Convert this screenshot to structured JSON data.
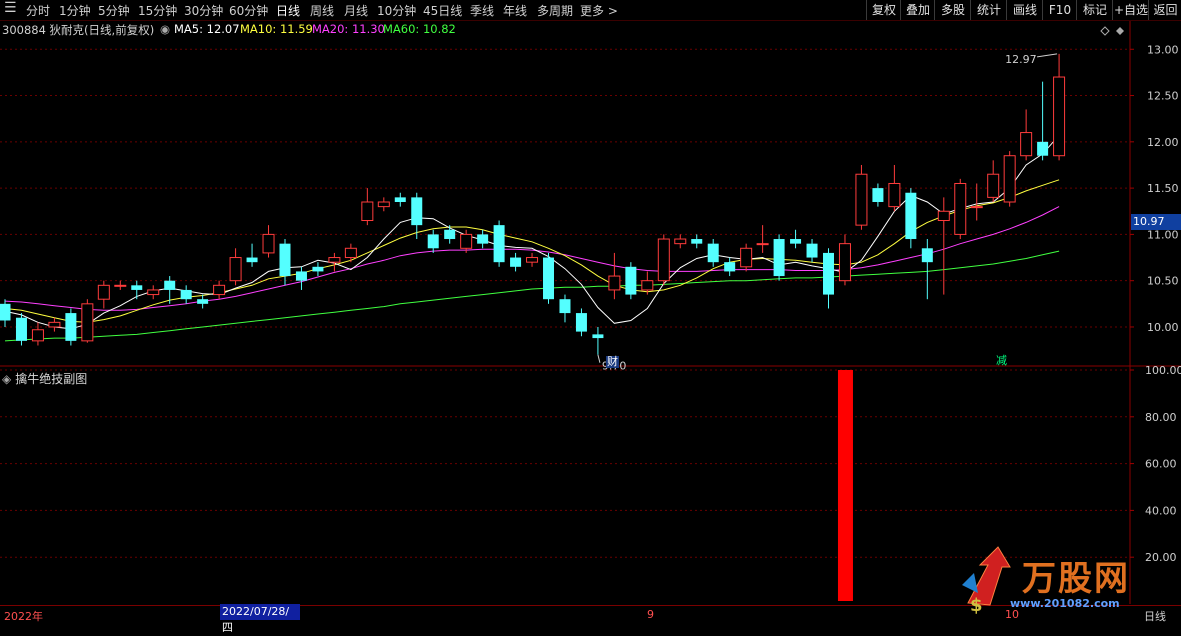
{
  "toolbar": {
    "periods": [
      "分时",
      "1分钟",
      "5分钟",
      "15分钟",
      "30分钟",
      "60分钟",
      "日线",
      "周线",
      "月线",
      "10分钟",
      "45日线",
      "季线",
      "年线",
      "多周期",
      "更多 >"
    ],
    "active": "日线",
    "right_buttons": [
      "复权",
      "叠加",
      "多股",
      "统计",
      "画线",
      "F10",
      "标记",
      "+自选",
      "返回"
    ]
  },
  "info": {
    "stock": "300884 狄耐克(日线,前复权)",
    "ma5": "MA5: 12.07",
    "ma10": "MA10: 11.59",
    "ma20": "MA20: 11.30",
    "ma60": "MA60: 10.82"
  },
  "colors": {
    "up": "#ff3c3c",
    "down": "#54ffff",
    "ma5": "#ffffff",
    "ma10": "#ffff40",
    "ma20": "#ff40ff",
    "ma60": "#40ff40",
    "indicator_bar": "#ff0000"
  },
  "annotations": {
    "high": "12.97",
    "low": "9.70",
    "cai": "财",
    "jian": "减"
  },
  "price_badge": "10.97",
  "sub_title": "擒牛绝技副图",
  "bottom": {
    "year": "2022年",
    "cursor_date": "2022/07/28/四",
    "m9": "9",
    "m10": "10",
    "period": "日线"
  },
  "watermark": {
    "text": "万股网",
    "url": "www.201082.com"
  },
  "chart_data": [
    {
      "type": "candlestick",
      "y_ticks": [
        10.0,
        10.5,
        11.0,
        11.5,
        12.0,
        12.5,
        13.0
      ],
      "ylim": [
        9.6,
        13.1
      ],
      "candles": [
        [
          10.25,
          10.07,
          10.3,
          10.0
        ],
        [
          10.1,
          9.85,
          10.15,
          9.8
        ],
        [
          9.85,
          9.97,
          10.05,
          9.8
        ],
        [
          10.0,
          10.05,
          10.1,
          9.95
        ],
        [
          10.15,
          9.85,
          10.2,
          9.8
        ],
        [
          9.85,
          10.25,
          10.3,
          9.83
        ],
        [
          10.3,
          10.45,
          10.5,
          10.2
        ],
        [
          10.45,
          10.45,
          10.5,
          10.4
        ],
        [
          10.45,
          10.4,
          10.5,
          10.3
        ],
        [
          10.35,
          10.4,
          10.45,
          10.3
        ],
        [
          10.5,
          10.4,
          10.55,
          10.25
        ],
        [
          10.4,
          10.3,
          10.45,
          10.25
        ],
        [
          10.3,
          10.25,
          10.35,
          10.2
        ],
        [
          10.35,
          10.45,
          10.5,
          10.3
        ],
        [
          10.5,
          10.75,
          10.85,
          10.45
        ],
        [
          10.75,
          10.7,
          10.9,
          10.65
        ],
        [
          10.8,
          11.0,
          11.1,
          10.75
        ],
        [
          10.9,
          10.55,
          10.95,
          10.45
        ],
        [
          10.6,
          10.5,
          10.65,
          10.4
        ],
        [
          10.65,
          10.6,
          10.7,
          10.55
        ],
        [
          10.7,
          10.75,
          10.8,
          10.6
        ],
        [
          10.75,
          10.85,
          10.9,
          10.7
        ],
        [
          11.15,
          11.35,
          11.5,
          11.1
        ],
        [
          11.3,
          11.35,
          11.4,
          11.25
        ],
        [
          11.4,
          11.35,
          11.45,
          11.3
        ],
        [
          11.4,
          11.1,
          11.45,
          10.95
        ],
        [
          11.0,
          10.85,
          11.05,
          10.8
        ],
        [
          11.05,
          10.95,
          11.1,
          10.9
        ],
        [
          10.85,
          11.0,
          11.05,
          10.8
        ],
        [
          11.0,
          10.9,
          11.05,
          10.85
        ],
        [
          11.1,
          10.7,
          11.15,
          10.65
        ],
        [
          10.75,
          10.65,
          10.8,
          10.6
        ],
        [
          10.7,
          10.75,
          10.8,
          10.65
        ],
        [
          10.75,
          10.3,
          10.8,
          10.25
        ],
        [
          10.3,
          10.15,
          10.35,
          10.05
        ],
        [
          10.15,
          9.95,
          10.2,
          9.9
        ],
        [
          9.92,
          9.88,
          10.0,
          9.7
        ],
        [
          10.4,
          10.55,
          10.8,
          10.3
        ],
        [
          10.65,
          10.35,
          10.7,
          10.3
        ],
        [
          10.4,
          10.5,
          10.6,
          10.35
        ],
        [
          10.5,
          10.95,
          11.0,
          10.45
        ],
        [
          10.9,
          10.95,
          11.0,
          10.85
        ],
        [
          10.95,
          10.9,
          11.0,
          10.85
        ],
        [
          10.9,
          10.7,
          10.95,
          10.65
        ],
        [
          10.7,
          10.6,
          10.75,
          10.55
        ],
        [
          10.65,
          10.85,
          10.9,
          10.6
        ],
        [
          10.9,
          10.9,
          11.1,
          10.8
        ],
        [
          10.95,
          10.55,
          11.0,
          10.5
        ],
        [
          10.95,
          10.9,
          11.05,
          10.85
        ],
        [
          10.9,
          10.75,
          10.95,
          10.7
        ],
        [
          10.8,
          10.35,
          10.85,
          10.2
        ],
        [
          10.5,
          10.9,
          11.0,
          10.45
        ],
        [
          11.1,
          11.65,
          11.75,
          11.05
        ],
        [
          11.5,
          11.35,
          11.55,
          11.3
        ],
        [
          11.3,
          11.55,
          11.75,
          11.25
        ],
        [
          11.45,
          10.95,
          11.5,
          10.85
        ],
        [
          10.85,
          10.7,
          10.95,
          10.3
        ],
        [
          11.15,
          11.25,
          11.4,
          10.35
        ],
        [
          11.0,
          11.55,
          11.6,
          10.95
        ],
        [
          11.3,
          11.3,
          11.55,
          11.15
        ],
        [
          11.4,
          11.65,
          11.8,
          11.35
        ],
        [
          11.35,
          11.85,
          11.9,
          11.3
        ],
        [
          11.85,
          12.1,
          12.35,
          11.8
        ],
        [
          12.0,
          11.85,
          12.65,
          11.8
        ],
        [
          11.85,
          12.7,
          12.95,
          11.8
        ]
      ],
      "ma5": [
        10.17,
        10.13,
        10.05,
        10.0,
        9.98,
        10.03,
        10.15,
        10.23,
        10.33,
        10.39,
        10.42,
        10.39,
        10.36,
        10.35,
        10.42,
        10.48,
        10.6,
        10.64,
        10.65,
        10.72,
        10.69,
        10.62,
        10.75,
        10.95,
        11.13,
        11.18,
        11.17,
        11.07,
        10.99,
        10.94,
        10.88,
        10.86,
        10.85,
        10.76,
        10.63,
        10.46,
        10.21,
        10.04,
        10.07,
        10.2,
        10.47,
        10.64,
        10.74,
        10.78,
        10.75,
        10.73,
        10.75,
        10.67,
        10.7,
        10.66,
        10.63,
        10.59,
        10.72,
        10.98,
        11.25,
        11.42,
        11.35,
        11.22,
        11.28,
        11.33,
        11.35,
        11.5,
        11.75,
        11.87,
        12.07
      ],
      "ma10": [
        10.2,
        10.18,
        10.14,
        10.1,
        10.06,
        10.05,
        10.08,
        10.12,
        10.18,
        10.24,
        10.29,
        10.32,
        10.34,
        10.37,
        10.41,
        10.45,
        10.52,
        10.55,
        10.58,
        10.63,
        10.67,
        10.72,
        10.8,
        10.88,
        10.96,
        11.02,
        11.06,
        11.08,
        11.08,
        11.05,
        11.0,
        10.96,
        10.92,
        10.85,
        10.77,
        10.67,
        10.55,
        10.45,
        10.4,
        10.38,
        10.4,
        10.45,
        10.53,
        10.63,
        10.7,
        10.73,
        10.74,
        10.73,
        10.72,
        10.7,
        10.68,
        10.67,
        10.7,
        10.78,
        10.9,
        11.03,
        11.13,
        11.2,
        11.26,
        11.31,
        11.34,
        11.4,
        11.47,
        11.53,
        11.59
      ],
      "ma20": [
        10.28,
        10.27,
        10.25,
        10.23,
        10.21,
        10.19,
        10.18,
        10.18,
        10.19,
        10.21,
        10.23,
        10.25,
        10.28,
        10.3,
        10.33,
        10.37,
        10.41,
        10.45,
        10.49,
        10.54,
        10.59,
        10.63,
        10.68,
        10.72,
        10.77,
        10.8,
        10.82,
        10.83,
        10.83,
        10.84,
        10.84,
        10.84,
        10.83,
        10.81,
        10.78,
        10.74,
        10.7,
        10.66,
        10.63,
        10.61,
        10.6,
        10.6,
        10.6,
        10.61,
        10.62,
        10.62,
        10.62,
        10.62,
        10.61,
        10.61,
        10.61,
        10.62,
        10.64,
        10.67,
        10.71,
        10.75,
        10.79,
        10.84,
        10.9,
        10.95,
        11.0,
        11.06,
        11.13,
        11.21,
        11.3
      ],
      "ma60": [
        9.85,
        9.86,
        9.87,
        9.88,
        9.88,
        9.89,
        9.9,
        9.91,
        9.92,
        9.94,
        9.96,
        9.98,
        10.0,
        10.02,
        10.04,
        10.06,
        10.08,
        10.1,
        10.12,
        10.14,
        10.16,
        10.18,
        10.2,
        10.22,
        10.25,
        10.27,
        10.29,
        10.31,
        10.33,
        10.35,
        10.37,
        10.39,
        10.41,
        10.42,
        10.43,
        10.43,
        10.44,
        10.44,
        10.45,
        10.45,
        10.46,
        10.47,
        10.48,
        10.49,
        10.5,
        10.5,
        10.51,
        10.52,
        10.53,
        10.53,
        10.54,
        10.55,
        10.56,
        10.57,
        10.58,
        10.59,
        10.6,
        10.62,
        10.64,
        10.66,
        10.68,
        10.71,
        10.74,
        10.78,
        10.82
      ]
    },
    {
      "type": "bar",
      "title": "擒牛绝技副图",
      "y_ticks": [
        20.0,
        40.0,
        60.0,
        80.0,
        100.0
      ],
      "ylim": [
        0,
        100
      ],
      "bars": [
        {
          "index": 51,
          "value": 100
        }
      ]
    }
  ]
}
